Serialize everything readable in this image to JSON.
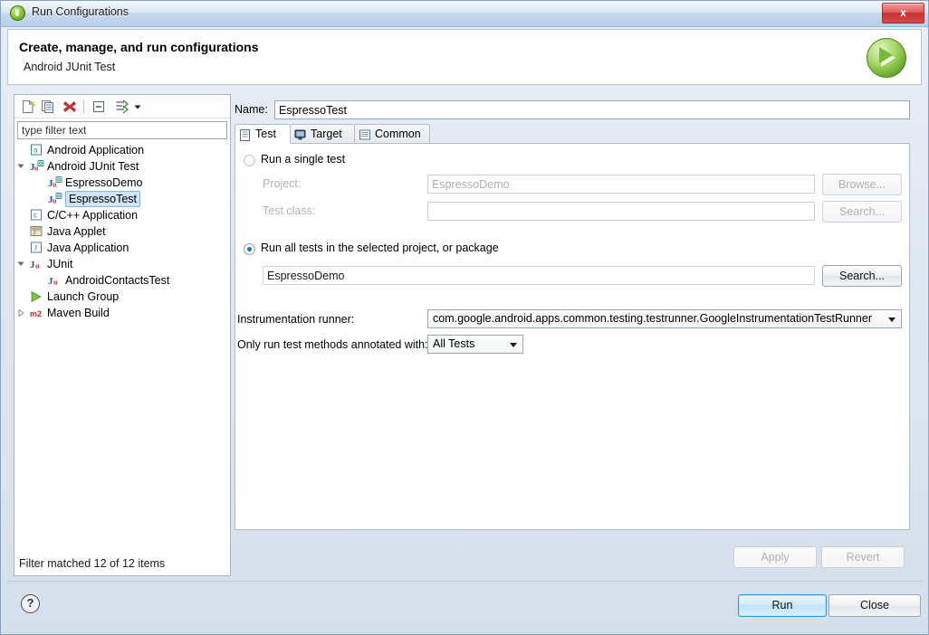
{
  "window": {
    "title": "Run Configurations",
    "close_label": "x",
    "app_icon": "eclipse-run-icon"
  },
  "header": {
    "title": "Create, manage, and run configurations",
    "subtitle": "Android JUnit Test",
    "run_orb_icon": "green-play-orb-icon"
  },
  "left_panel": {
    "toolbar": [
      {
        "name": "new-launch-configuration-icon",
        "tooltip": "New launch configuration"
      },
      {
        "name": "duplicate-configuration-icon",
        "tooltip": "Duplicate"
      },
      {
        "name": "delete-configuration-icon",
        "tooltip": "Delete"
      },
      {
        "name": "collapse-all-icon",
        "tooltip": "Collapse All"
      },
      {
        "name": "filter-configurations-icon",
        "tooltip": "Filter"
      },
      {
        "name": "chevron-down-icon",
        "tooltip": "Menu"
      }
    ],
    "filter": {
      "value": "type filter text",
      "placeholder": "type filter text"
    },
    "tree": [
      {
        "label": "Android Application",
        "indent": 1,
        "icon": "android-application-icon",
        "twisty": "none",
        "selected": false
      },
      {
        "label": "Android JUnit Test",
        "indent": 1,
        "icon": "android-junit-icon",
        "twisty": "expanded",
        "selected": false
      },
      {
        "label": "EspressoDemo",
        "indent": 2,
        "icon": "android-junit-icon",
        "twisty": "none",
        "selected": false
      },
      {
        "label": "EspressoTest",
        "indent": 2,
        "icon": "android-junit-icon",
        "twisty": "none",
        "selected": true
      },
      {
        "label": "C/C++ Application",
        "indent": 1,
        "icon": "c-application-icon",
        "twisty": "none",
        "selected": false
      },
      {
        "label": "Java Applet",
        "indent": 1,
        "icon": "java-applet-icon",
        "twisty": "none",
        "selected": false
      },
      {
        "label": "Java Application",
        "indent": 1,
        "icon": "java-application-icon",
        "twisty": "none",
        "selected": false
      },
      {
        "label": "JUnit",
        "indent": 1,
        "icon": "junit-icon",
        "twisty": "expanded",
        "selected": false
      },
      {
        "label": "AndroidContactsTest",
        "indent": 2,
        "icon": "junit-icon",
        "twisty": "none",
        "selected": false
      },
      {
        "label": "Launch Group",
        "indent": 1,
        "icon": "launch-group-icon",
        "twisty": "none",
        "selected": false
      },
      {
        "label": "Maven Build",
        "indent": 1,
        "icon": "maven-build-icon",
        "twisty": "collapsed",
        "selected": false
      }
    ],
    "filter_status": "Filter matched 12 of 12 items"
  },
  "main": {
    "name_label": "Name:",
    "name_value": "EspressoTest",
    "tabs": [
      {
        "label": "Test",
        "icon": "test-tab-icon",
        "active": true
      },
      {
        "label": "Target",
        "icon": "target-tab-icon",
        "active": false
      },
      {
        "label": "Common",
        "icon": "common-tab-icon",
        "active": false
      }
    ],
    "single_test": {
      "radio_label": "Run a single test",
      "selected": false,
      "project_label": "Project:",
      "project_value": "EspressoDemo",
      "project_button": "Browse...",
      "testclass_label": "Test class:",
      "testclass_value": "",
      "testclass_button": "Search..."
    },
    "all_tests": {
      "radio_label": "Run all tests in the selected project, or package",
      "selected": true,
      "value": "EspressoDemo",
      "button": "Search..."
    },
    "instrumentation": {
      "label": "Instrumentation runner:",
      "value": "com.google.android.apps.common.testing.testrunner.GoogleInstrumentationTestRunner"
    },
    "annotation": {
      "label": "Only run test methods annotated with:",
      "value": "All Tests"
    },
    "apply_button": "Apply",
    "revert_button": "Revert"
  },
  "footer": {
    "help_icon": "help-question-icon",
    "help_glyph": "?",
    "run_button": "Run",
    "close_button": "Close"
  }
}
